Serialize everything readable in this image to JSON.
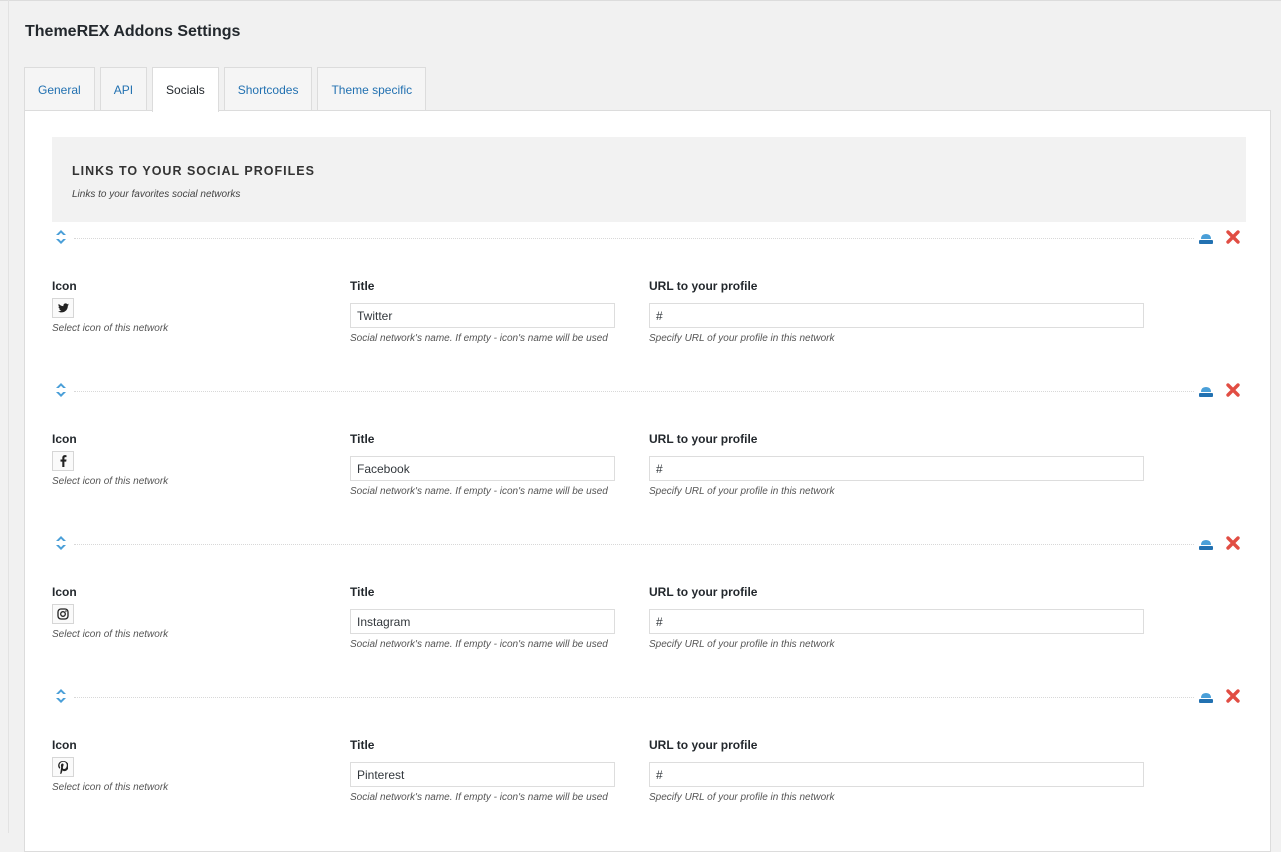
{
  "page": {
    "title": "ThemeREX Addons Settings"
  },
  "tabs": [
    {
      "label": "General",
      "active": false
    },
    {
      "label": "API",
      "active": false
    },
    {
      "label": "Socials",
      "active": true
    },
    {
      "label": "Shortcodes",
      "active": false
    },
    {
      "label": "Theme specific",
      "active": false
    }
  ],
  "section": {
    "title": "LINKS TO YOUR SOCIAL PROFILES",
    "description": "Links to your favorites social networks"
  },
  "labels": {
    "icon": "Icon",
    "title": "Title",
    "url": "URL to your profile",
    "icon_hint": "Select icon of this network",
    "title_hint": "Social network's name. If empty - icon's name will be used",
    "url_hint": "Specify URL of your profile in this network"
  },
  "socials": [
    {
      "icon": "twitter-icon",
      "title": "Twitter",
      "url": "#"
    },
    {
      "icon": "facebook-icon",
      "title": "Facebook",
      "url": "#"
    },
    {
      "icon": "instagram-icon",
      "title": "Instagram",
      "url": "#"
    },
    {
      "icon": "pinterest-icon",
      "title": "Pinterest",
      "url": "#"
    }
  ],
  "colors": {
    "link": "#2271b1",
    "handle": "#4a9fd8",
    "delete": "#e14d43"
  }
}
